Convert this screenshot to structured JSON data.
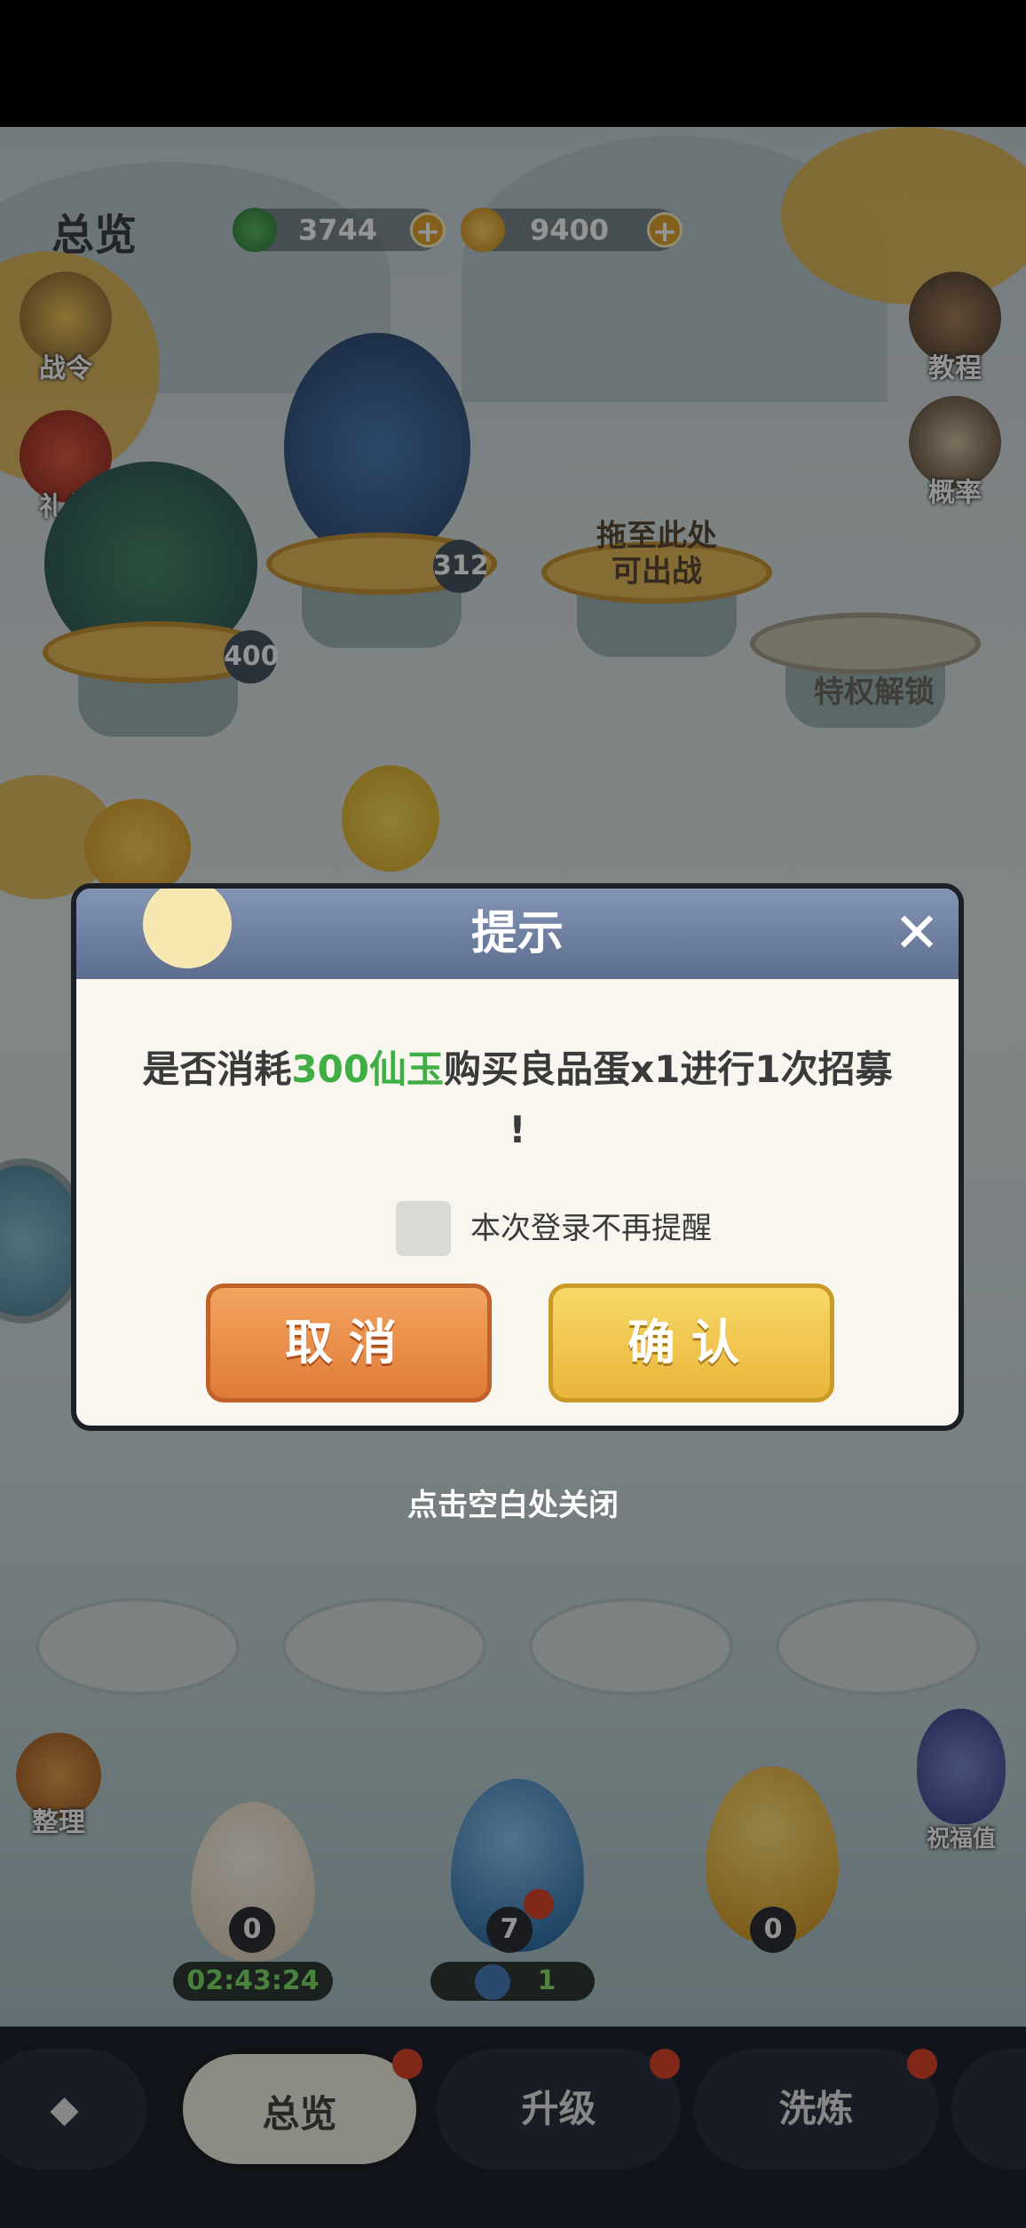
{
  "header": {
    "title": "总览",
    "jade": {
      "value": "3744",
      "icon": "green-jade-icon"
    },
    "gold": {
      "value": "9400",
      "icon": "gold-coin-icon"
    }
  },
  "side_left": {
    "battle_pass": "战令",
    "gift": "礼包"
  },
  "side_right": {
    "tutorial": "教程",
    "probability": "概率"
  },
  "pedestals": {
    "count1": "400",
    "count2": "312",
    "drag_text": "拖至此处\n可出战",
    "locked_text": "特权解锁"
  },
  "left_tools": {
    "organize": "整理"
  },
  "blessing": {
    "label": "祝福值"
  },
  "eggs": {
    "egg1_count": "0",
    "egg2_count": "7",
    "egg3_count": "0",
    "timer": "02:43:24",
    "egg2_bar": "1"
  },
  "bottom_nav": {
    "tabs": [
      "总览",
      "升级",
      "洗炼"
    ]
  },
  "dialog": {
    "title": "提示",
    "msg_prefix": "是否消耗",
    "msg_highlight": "300仙玉",
    "msg_suffix": "购买良品蛋x1进行1次招募",
    "msg_end": "!",
    "checkbox_label": "本次登录不再提醒",
    "cancel": "取消",
    "confirm": "确认"
  },
  "hint": "点击空白处关闭",
  "colors": {
    "highlight_green": "#3fae45",
    "cancel_orange": "#e07a38",
    "confirm_yellow": "#e9b53a"
  }
}
